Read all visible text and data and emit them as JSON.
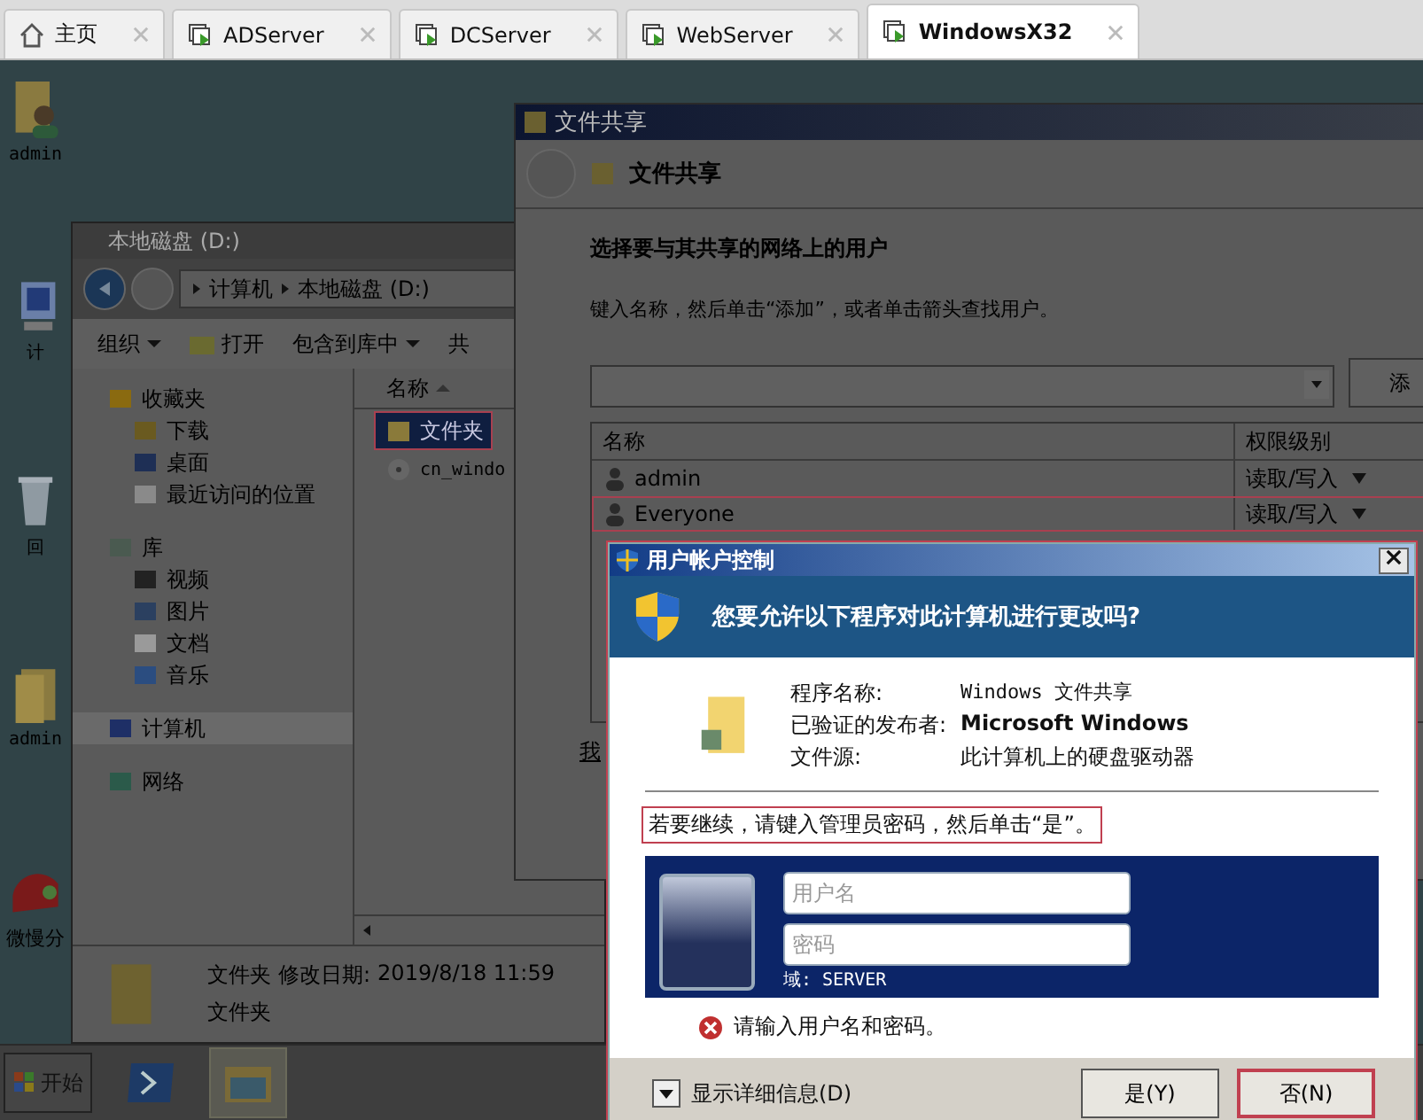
{
  "tabs": [
    {
      "label": "主页",
      "kind": "home",
      "selected": false
    },
    {
      "label": "ADServer",
      "kind": "vm",
      "selected": false
    },
    {
      "label": "DCServer",
      "kind": "vm",
      "selected": false
    },
    {
      "label": "WebServer",
      "kind": "vm",
      "selected": false
    },
    {
      "label": "WindowsX32",
      "kind": "vm",
      "selected": true
    }
  ],
  "desktop_icons": [
    {
      "label": "admin",
      "kind": "user"
    },
    {
      "label": "计",
      "kind": "computer"
    },
    {
      "label": "回",
      "kind": "recycle"
    },
    {
      "label": "admin",
      "kind": "folder"
    },
    {
      "label": "微慢分",
      "kind": "app"
    }
  ],
  "explorer": {
    "title": "本地磁盘 (D:)",
    "breadcrumb": [
      "计算机",
      "本地磁盘 (D:)"
    ],
    "toolbar": [
      {
        "label": "组织",
        "kind": "menu"
      },
      {
        "label": "打开",
        "kind": "open"
      },
      {
        "label": "包含到库中",
        "kind": "menu"
      },
      {
        "label": "共",
        "kind": "plain"
      }
    ],
    "nav": [
      {
        "label": "收藏夹",
        "kind": "star",
        "selected": false,
        "children": [
          {
            "label": "下载",
            "kind": "download",
            "selected": false
          },
          {
            "label": "桌面",
            "kind": "desktop",
            "selected": false
          },
          {
            "label": "最近访问的位置",
            "kind": "recent",
            "selected": false
          }
        ]
      },
      {
        "label": "库",
        "kind": "library",
        "selected": false,
        "children": [
          {
            "label": "视频",
            "kind": "video",
            "selected": false
          },
          {
            "label": "图片",
            "kind": "picture",
            "selected": false
          },
          {
            "label": "文档",
            "kind": "document",
            "selected": false
          },
          {
            "label": "音乐",
            "kind": "music",
            "selected": false
          }
        ]
      },
      {
        "label": "计算机",
        "kind": "computer",
        "selected": true
      },
      {
        "label": "网络",
        "kind": "network",
        "selected": false
      }
    ],
    "column": "名称",
    "files": [
      {
        "name": "文件夹",
        "kind": "folder",
        "selected": true,
        "highlighted": true
      },
      {
        "name": "cn_windo",
        "kind": "disc",
        "selected": false,
        "highlighted": false
      }
    ],
    "details": {
      "name": "文件夹",
      "date_label": "修改日期:",
      "date": "2019/8/18 11:59",
      "type": "文件夹"
    }
  },
  "share_dialog": {
    "title": "文件共享",
    "header": "文件共享",
    "heading": "选择要与其共享的网络上的用户",
    "instruction": "键入名称，然后单击“添加”，或者单击箭头查找用户。",
    "add_button": "添",
    "columns": [
      "名称",
      "权限级别"
    ],
    "rows": [
      {
        "name": "admin",
        "permission": "读取/写入",
        "highlighted": false
      },
      {
        "name": "Everyone",
        "permission": "读取/写入",
        "highlighted": true
      }
    ],
    "link": "我"
  },
  "uac": {
    "title": "用户帐户控制",
    "question": "您要允许以下程序对此计算机进行更改吗?",
    "details": [
      {
        "label": "程序名称:",
        "value": "Windows 文件共享",
        "kind": "mono"
      },
      {
        "label": "已验证的发布者:",
        "value": "Microsoft Windows",
        "kind": "bold"
      },
      {
        "label": "文件源:",
        "value": "此计算机上的硬盘驱动器",
        "kind": "plain"
      }
    ],
    "prompt": "若要继续，请键入管理员密码，然后单击“是”。",
    "prompt_highlighted": true,
    "username": {
      "placeholder": "用户名"
    },
    "password": {
      "placeholder": "密码"
    },
    "domain": "域: SERVER",
    "error": "请输入用户名和密码。",
    "details_toggle": "显示详细信息(D)",
    "buttons": [
      {
        "label": "是(Y)",
        "highlighted": false
      },
      {
        "label": "否(N)",
        "highlighted": true
      }
    ]
  },
  "taskbar": {
    "start": "开始",
    "apps": [
      {
        "kind": "shell",
        "selected": false
      },
      {
        "kind": "explorer",
        "selected": true
      }
    ]
  }
}
